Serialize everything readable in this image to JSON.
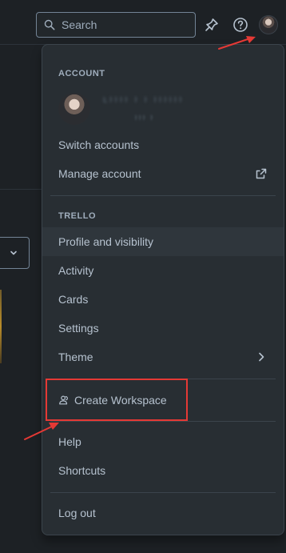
{
  "header": {
    "search": {
      "placeholder": "Search",
      "icon": "search-icon"
    },
    "icons": [
      "notifications-icon",
      "help-icon"
    ],
    "avatar": "user-avatar"
  },
  "menu": {
    "account": {
      "heading": "ACCOUNT",
      "name": "Ŀŀŀŀŀ ŀ ŀ ŀŀŀŀŀŀ",
      "email": "ŀŀŀ ŀ",
      "items": [
        {
          "label": "Switch accounts"
        },
        {
          "label": "Manage account",
          "icon": "external-link-icon"
        }
      ]
    },
    "trello": {
      "heading": "TRELLO",
      "items": [
        {
          "label": "Profile and visibility"
        },
        {
          "label": "Activity"
        },
        {
          "label": "Cards"
        },
        {
          "label": "Settings"
        },
        {
          "label": "Theme",
          "icon": "chevron-right-icon"
        }
      ]
    },
    "create_workspace": {
      "label": "Create Workspace",
      "icon": "people-icon"
    },
    "support": {
      "items": [
        {
          "label": "Help"
        },
        {
          "label": "Shortcuts"
        }
      ]
    },
    "logout": {
      "label": "Log out"
    }
  },
  "colors": {
    "page_bg": "#1d2125",
    "menu_bg": "#282e33",
    "hover_bg": "#2f363c",
    "text": "#b6c2cf",
    "muted_text": "#9fadbc",
    "annotation": "#e53935"
  }
}
